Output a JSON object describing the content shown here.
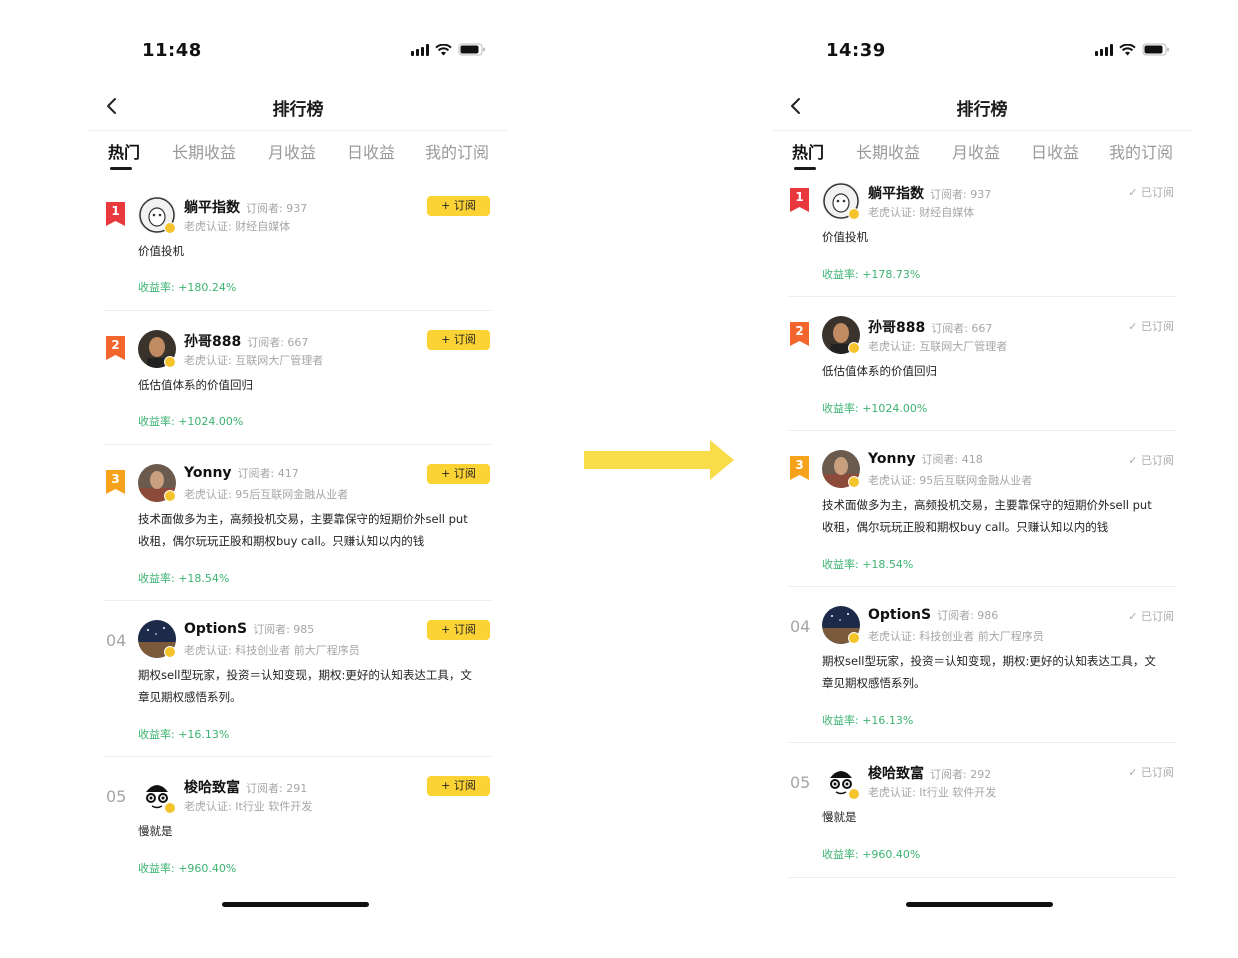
{
  "colors": {
    "accent_yellow": "#fbd334",
    "rank1": "#e8383d",
    "rank2": "#f2662e",
    "rank3": "#f7a21b",
    "yield_green": "#3cb371",
    "arrow": "#f9dc4a"
  },
  "left": {
    "status_time": "11:48",
    "nav_title": "排行榜",
    "tabs": [
      "热门",
      "长期收益",
      "月收益",
      "日收益",
      "我的订阅"
    ],
    "subscribe_label": "+ 订阅",
    "items": [
      {
        "rank": "1",
        "name": "躺平指数",
        "subs": "订阅者: 937",
        "cert": "老虎认证:  财经自媒体",
        "desc": "价值投机",
        "yield": "收益率: +180.24%"
      },
      {
        "rank": "2",
        "name": "孙哥888",
        "subs": "订阅者: 667",
        "cert": "老虎认证:  互联网大厂管理者",
        "desc": "低估值体系的价值回归",
        "yield": "收益率: +1024.00%"
      },
      {
        "rank": "3",
        "name": "Yonny",
        "subs": "订阅者: 417",
        "cert": "老虎认证:  95后互联网金融从业者",
        "desc": "技术面做多为主，高频投机交易，主要靠保守的短期价外sell put收租，偶尔玩玩正股和期权buy call。只赚认知以内的钱",
        "yield": "收益率: +18.54%"
      },
      {
        "rank": "04",
        "name": "OptionS",
        "subs": "订阅者: 985",
        "cert": "老虎认证:  科技创业者 前大厂程序员",
        "desc": "期权sell型玩家，投资＝认知变现，期权:更好的认知表达工具，文章见期权感悟系列。",
        "yield": "收益率: +16.13%"
      },
      {
        "rank": "05",
        "name": "梭哈致富",
        "subs": "订阅者: 291",
        "cert": "老虎认证:  It行业 软件开发",
        "desc": "慢就是",
        "yield": "收益率: +960.40%"
      }
    ]
  },
  "right": {
    "status_time": "14:39",
    "nav_title": "排行榜",
    "tabs": [
      "热门",
      "长期收益",
      "月收益",
      "日收益",
      "我的订阅"
    ],
    "subscribed_label": "已订阅",
    "items": [
      {
        "rank": "1",
        "name": "躺平指数",
        "subs": "订阅者: 937",
        "cert": "老虎认证:  财经自媒体",
        "desc": "价值投机",
        "yield": "收益率: +178.73%"
      },
      {
        "rank": "2",
        "name": "孙哥888",
        "subs": "订阅者: 667",
        "cert": "老虎认证:  互联网大厂管理者",
        "desc": "低估值体系的价值回归",
        "yield": "收益率: +1024.00%"
      },
      {
        "rank": "3",
        "name": "Yonny",
        "subs": "订阅者: 418",
        "cert": "老虎认证:  95后互联网金融从业者",
        "desc": "技术面做多为主，高频投机交易，主要靠保守的短期价外sell put收租，偶尔玩玩正股和期权buy call。只赚认知以内的钱",
        "yield": "收益率: +18.54%"
      },
      {
        "rank": "04",
        "name": "OptionS",
        "subs": "订阅者: 986",
        "cert": "老虎认证:  科技创业者 前大厂程序员",
        "desc": "期权sell型玩家，投资＝认知变现，期权:更好的认知表达工具，文章见期权感悟系列。",
        "yield": "收益率: +16.13%"
      },
      {
        "rank": "05",
        "name": "梭哈致富",
        "subs": "订阅者: 292",
        "cert": "老虎认证:  It行业 软件开发",
        "desc": "慢就是",
        "yield": "收益率: +960.40%"
      }
    ]
  }
}
